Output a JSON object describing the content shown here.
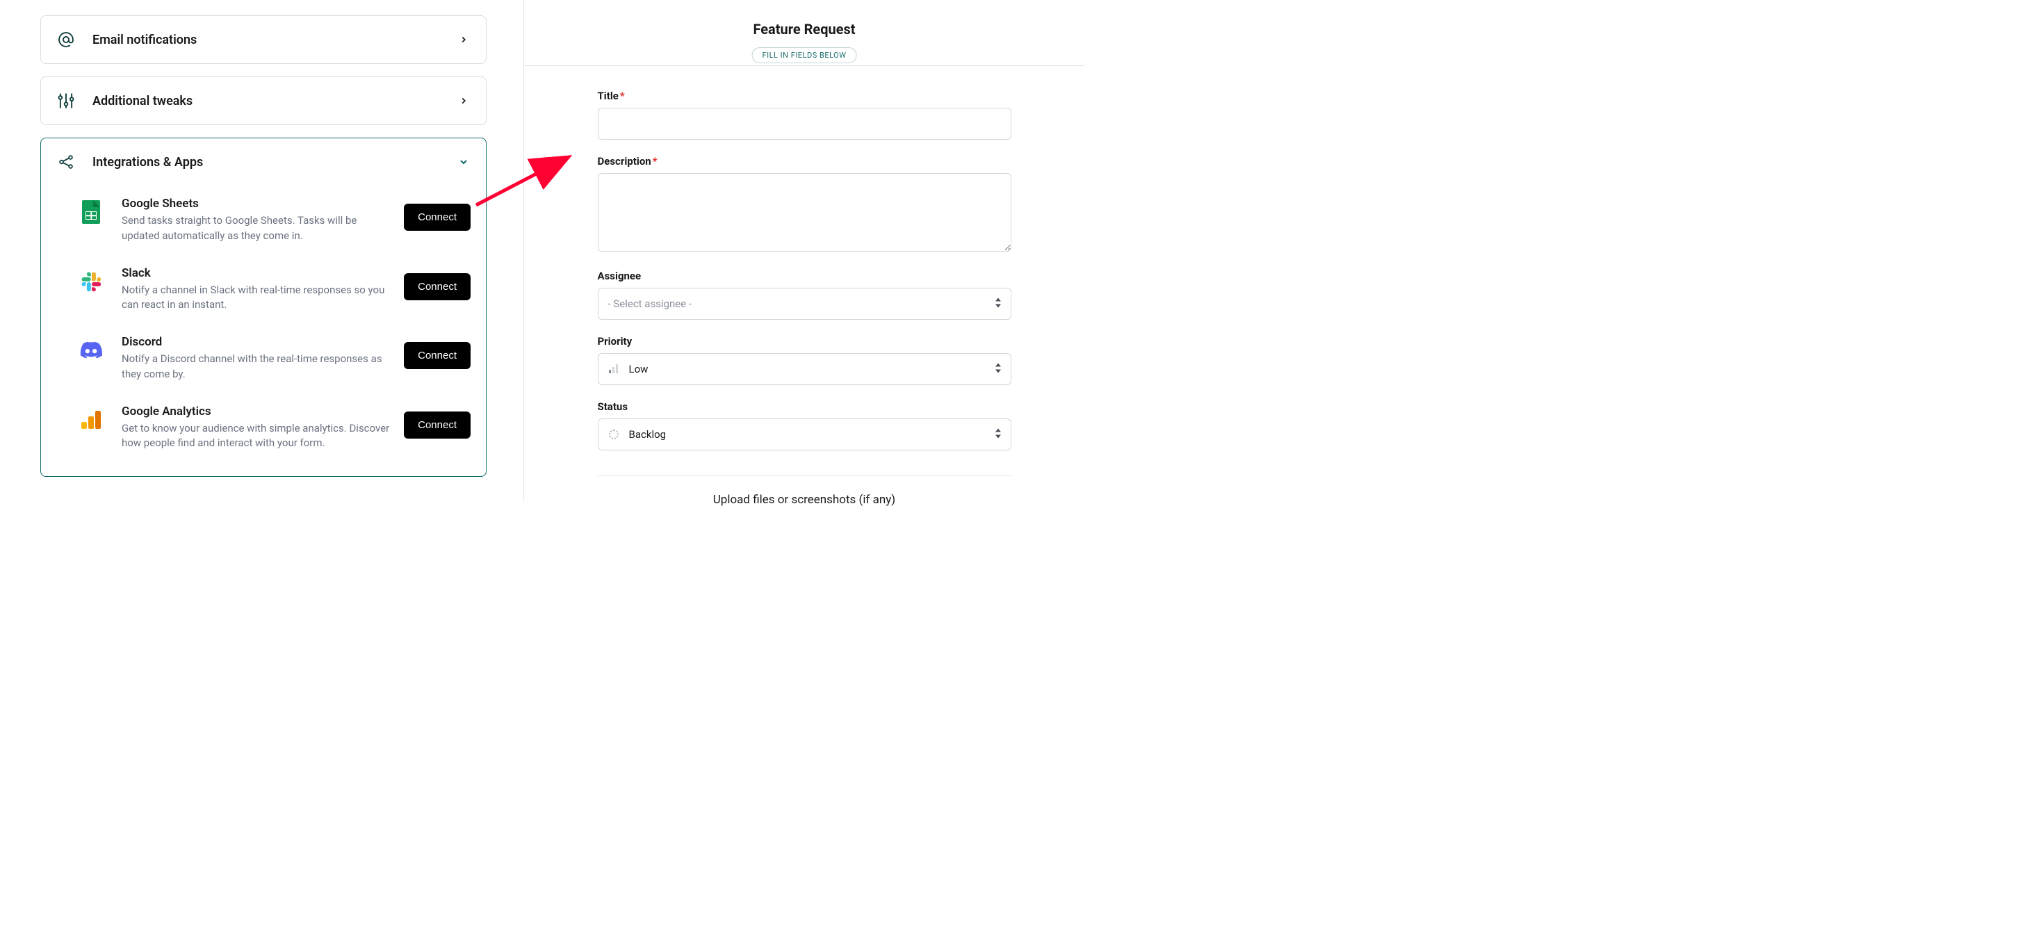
{
  "left": {
    "cards": [
      {
        "title": "Email notifications"
      },
      {
        "title": "Additional tweaks"
      },
      {
        "title": "Integrations & Apps"
      }
    ],
    "integrations": [
      {
        "name": "Google Sheets",
        "desc": "Send tasks straight to Google Sheets. Tasks will be updated automatically as they come in.",
        "button": "Connect"
      },
      {
        "name": "Slack",
        "desc": "Notify a channel in Slack with real-time responses so you can react in an instant.",
        "button": "Connect"
      },
      {
        "name": "Discord",
        "desc": "Notify a Discord channel with the real-time responses as they come by.",
        "button": "Connect"
      },
      {
        "name": "Google Analytics",
        "desc": "Get to know your audience with simple analytics. Discover how people find and interact with your form.",
        "button": "Connect"
      }
    ]
  },
  "form": {
    "title": "Feature Request",
    "badge": "FILL IN FIELDS BELOW",
    "fields": {
      "title_label": "Title",
      "description_label": "Description",
      "assignee_label": "Assignee",
      "assignee_placeholder": "- Select assignee -",
      "priority_label": "Priority",
      "priority_value": "Low",
      "status_label": "Status",
      "status_value": "Backlog"
    },
    "upload_hint": "Upload files or screenshots (if any)"
  }
}
